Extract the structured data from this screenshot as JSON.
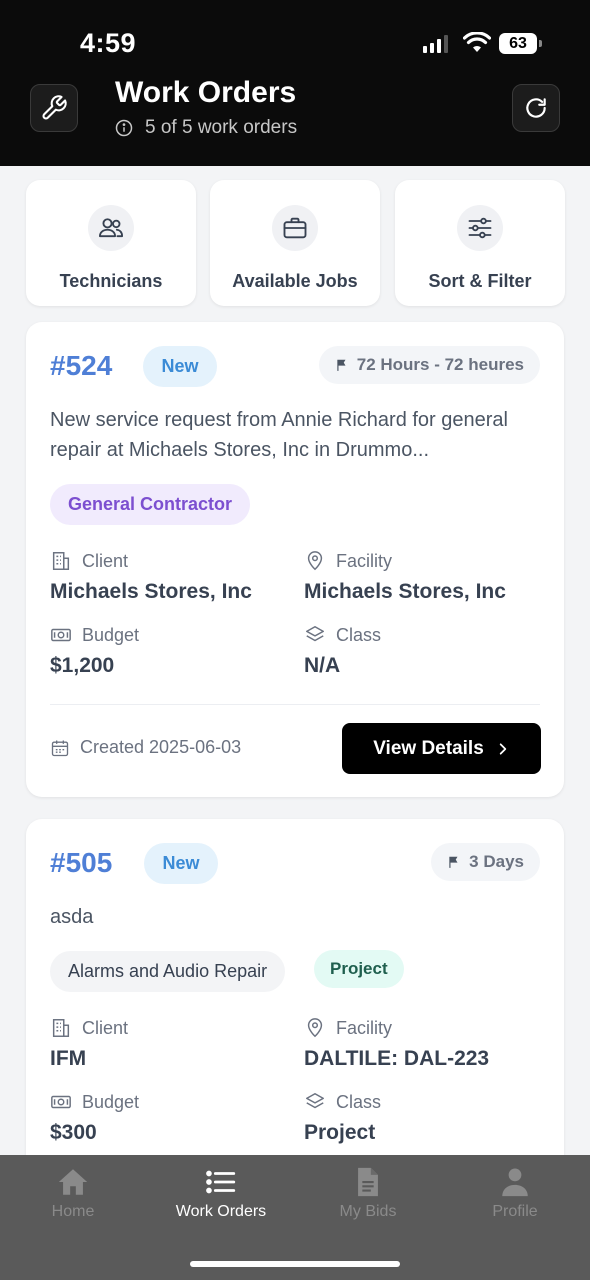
{
  "status_bar": {
    "time": "4:59",
    "battery": "63"
  },
  "header": {
    "title": "Work Orders",
    "subtitle": "5 of 5 work orders"
  },
  "quick_actions": [
    {
      "label": "Technicians",
      "icon": "users-icon"
    },
    {
      "label": "Available Jobs",
      "icon": "briefcase-icon"
    },
    {
      "label": "Sort & Filter",
      "icon": "sliders-icon"
    }
  ],
  "work_orders": [
    {
      "id": "#524",
      "status": "New",
      "priority": "72 Hours - 72 heures",
      "description": "New service request from Annie Richard for general repair at Michaels Stores, Inc in Drummo...",
      "tags": [
        "General Contractor"
      ],
      "client_label": "Client",
      "client": "Michaels Stores, Inc",
      "facility_label": "Facility",
      "facility": "Michaels Stores, Inc",
      "budget_label": "Budget",
      "budget": "$1,200",
      "class_label": "Class",
      "class": "N/A",
      "created": "Created 2025-06-03",
      "action": "View Details"
    },
    {
      "id": "#505",
      "status": "New",
      "priority": "3 Days",
      "description": "asda",
      "tags": [
        "Alarms and Audio Repair",
        "Project"
      ],
      "client_label": "Client",
      "client": "IFM",
      "facility_label": "Facility",
      "facility": "DALTILE: DAL-223",
      "budget_label": "Budget",
      "budget": "$300",
      "class_label": "Class",
      "class": "Project"
    }
  ],
  "tabbar": [
    {
      "label": "Home",
      "icon": "home-icon",
      "active": false
    },
    {
      "label": "Work Orders",
      "icon": "list-icon",
      "active": true
    },
    {
      "label": "My Bids",
      "icon": "document-icon",
      "active": false
    },
    {
      "label": "Profile",
      "icon": "person-icon",
      "active": false
    }
  ],
  "colors": {
    "accent": "#4f7fd6",
    "header_bg": "#0b0b0b",
    "tabbar_bg": "#5a5a5a"
  }
}
